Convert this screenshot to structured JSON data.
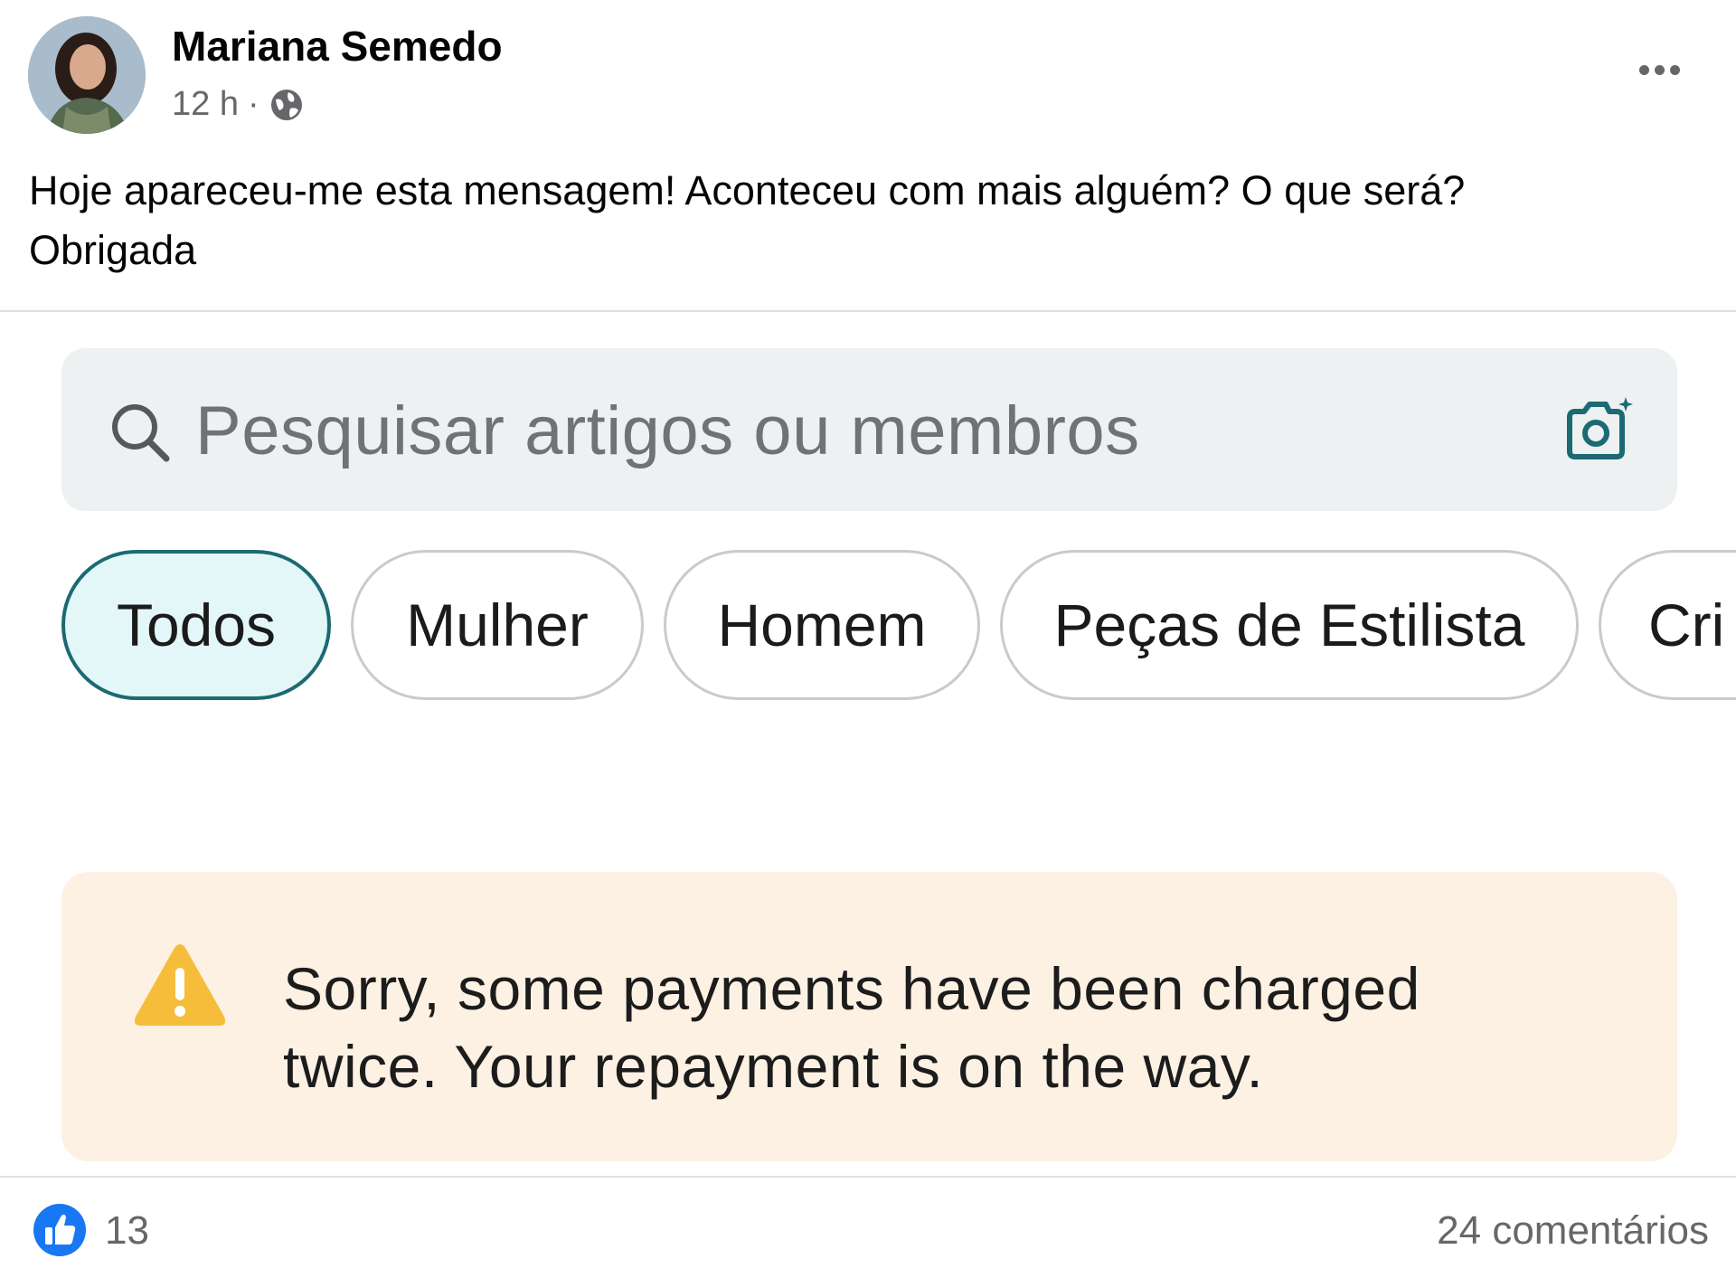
{
  "post": {
    "author": "Mariana Semedo",
    "time": "12 h",
    "separator": "·",
    "text_line1": "Hoje apareceu-me esta mensagem! Aconteceu com mais alguém? O que será?",
    "text_line2": "Obrigada"
  },
  "screenshot": {
    "search_placeholder": "Pesquisar artigos ou membros",
    "chips": [
      {
        "label": "Todos",
        "active": true
      },
      {
        "label": "Mulher",
        "active": false
      },
      {
        "label": "Homem",
        "active": false
      },
      {
        "label": "Peças de Estilista",
        "active": false
      },
      {
        "label": "Cri",
        "active": false
      }
    ],
    "notice_line1": "Sorry, some payments have been charged",
    "notice_line2": "twice. Your repayment is on the way."
  },
  "footer": {
    "like_count": "13",
    "comments": "24 comentários"
  },
  "icons": {
    "globe": "globe-icon",
    "more": "more-options-icon",
    "search": "search-icon",
    "camera": "camera-plus-icon",
    "warning": "warning-icon",
    "like": "like-icon"
  },
  "colors": {
    "accent_teal": "#1c6a72",
    "active_chip_bg": "#e3f7f8",
    "warning_yellow": "#f6bd3b",
    "notice_bg": "#fcf1e3",
    "like_blue": "#1877f2"
  }
}
